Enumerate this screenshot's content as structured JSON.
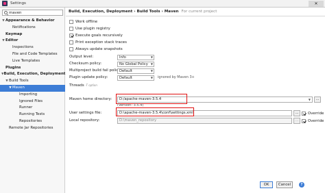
{
  "window": {
    "title": "Settings",
    "close_glyph": "✕"
  },
  "search": {
    "value": "maven",
    "placeholder": ""
  },
  "tree": [
    {
      "label": "Appearance & Behavior",
      "bold": true,
      "arrow": "▼",
      "indent": 0
    },
    {
      "label": "Notifications",
      "bold": false,
      "arrow": "",
      "indent": 2
    },
    {
      "label": "Keymap",
      "bold": true,
      "arrow": "",
      "indent": 0
    },
    {
      "label": "Editor",
      "bold": true,
      "arrow": "▼",
      "indent": 0
    },
    {
      "label": "Inspections",
      "bold": false,
      "arrow": "",
      "indent": 2
    },
    {
      "label": "File and Code Templates",
      "bold": false,
      "arrow": "",
      "indent": 2
    },
    {
      "label": "Live Templates",
      "bold": false,
      "arrow": "",
      "indent": 2
    },
    {
      "label": "Plugins",
      "bold": true,
      "arrow": "",
      "indent": 0
    },
    {
      "label": "Build, Execution, Deployment",
      "bold": true,
      "arrow": "▼",
      "indent": 0
    },
    {
      "label": "Build Tools",
      "bold": false,
      "arrow": "▼",
      "indent": 1
    },
    {
      "label": "Maven",
      "bold": false,
      "arrow": "▼",
      "indent": 2,
      "selected": true
    },
    {
      "label": "Importing",
      "bold": false,
      "arrow": "",
      "indent": 4
    },
    {
      "label": "Ignored Files",
      "bold": false,
      "arrow": "",
      "indent": 4
    },
    {
      "label": "Runner",
      "bold": false,
      "arrow": "",
      "indent": 4
    },
    {
      "label": "Running Tests",
      "bold": false,
      "arrow": "",
      "indent": 4
    },
    {
      "label": "Repositories",
      "bold": false,
      "arrow": "",
      "indent": 4
    },
    {
      "label": "Remote Jar Repositories",
      "bold": false,
      "arrow": "",
      "indent": 1
    }
  ],
  "breadcrumb": {
    "path": "Build, Execution, Deployment  ›  Build Tools  ›  Maven",
    "note": "For current project"
  },
  "options": [
    {
      "label": "Work offline",
      "checked": false
    },
    {
      "label": "Use plugin registry",
      "checked": false
    },
    {
      "label": "Execute goals recursively",
      "checked": true
    },
    {
      "label": "Print exception stack traces",
      "checked": false
    },
    {
      "label": "Always update snapshots",
      "checked": false
    }
  ],
  "settings": {
    "output_level": {
      "label": "Output level:",
      "value": "Info"
    },
    "checksum_policy": {
      "label": "Checksum policy:",
      "value": "No Global Policy"
    },
    "multiproject_fail_policy": {
      "label": "Multiproject build fail policy:",
      "value": "Default"
    },
    "plugin_update_policy": {
      "label": "Plugin update policy:",
      "value": "Default",
      "hint": "ignored by Maven 3+"
    },
    "threads": {
      "label": "Threads",
      "hint": "-T option"
    },
    "maven_home": {
      "label": "Maven home directory:",
      "value": "D:/apache-maven-3.5.4",
      "version": "(Version: 3.5.4)"
    },
    "user_settings": {
      "label": "User settings file:",
      "value": "D:\\apache-maven-3.5.4\\conf\\settings.xml",
      "override_label": "Override",
      "override": true
    },
    "local_repository": {
      "label": "Local repository:",
      "value": "D:\\maven_repository",
      "override_label": "Override",
      "override": true
    }
  },
  "buttons": {
    "ok": "OK",
    "cancel": "Cancel",
    "help": "?",
    "browse": "..."
  },
  "colors": {
    "selection": "#3d7dd6",
    "highlight": "#e01010"
  }
}
